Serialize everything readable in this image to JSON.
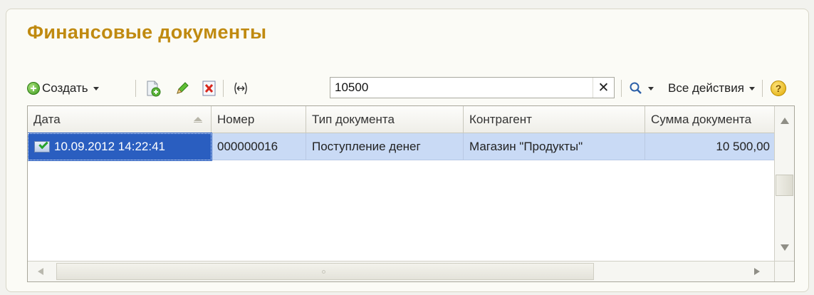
{
  "window": {
    "title": "Финансовые документы"
  },
  "toolbar": {
    "create_label": "Создать",
    "all_actions_label": "Все действия",
    "search": {
      "value": "10500",
      "placeholder": ""
    }
  },
  "table": {
    "columns": [
      "Дата",
      "Номер",
      "Тип документа",
      "Контрагент",
      "Сумма документа"
    ],
    "rows": [
      {
        "date": "10.09.2012 14:22:41",
        "number": "000000016",
        "type": "Поступление денег",
        "counterparty": "Магазин \"Продукты\"",
        "amount": "10 500,00"
      }
    ]
  },
  "colors": {
    "title": "#c08a10",
    "selected_row": "#c9daf5",
    "selected_cell": "#2a5ec0"
  },
  "icons": [
    "add-circle-icon",
    "copy-document-icon",
    "edit-pencil-icon",
    "delete-icon",
    "fit-width-icon",
    "clear-icon",
    "search-icon",
    "help-icon",
    "posted-document-icon"
  ]
}
